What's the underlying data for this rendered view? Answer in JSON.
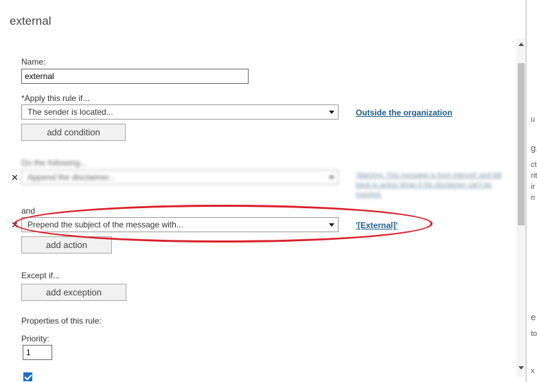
{
  "dialog": {
    "title": "external"
  },
  "name_field": {
    "label": "Name:",
    "value": "external"
  },
  "condition": {
    "label": "*Apply this rule if...",
    "selected": "The sender is located...",
    "value_link": "Outside the organization",
    "add_button": "add condition"
  },
  "blurred_action": {
    "label": "Do the following...",
    "selected": "Append the disclaimer...",
    "link_text": "'Warning: This message is from internet' and fall back to action Wrap if the disclaimer can't be inserted."
  },
  "action": {
    "and_label": "and",
    "selected": "Prepend the subject of the message with...",
    "value_link": "'[External]'",
    "add_button": "add action"
  },
  "exception": {
    "label": "Except if...",
    "add_button": "add exception"
  },
  "properties": {
    "label": "Properties of this rule:",
    "priority_label": "Priority:",
    "priority_value": "1",
    "audit_checked": true
  },
  "right_strip": {
    "fragments": [
      "u",
      "g.",
      "ct",
      "rit",
      "ir",
      "n",
      "e",
      "to",
      "x"
    ]
  },
  "colors": {
    "link": "#1f5f8b",
    "highlight": "#d9202b",
    "checkbox": "#1e6fc5"
  }
}
